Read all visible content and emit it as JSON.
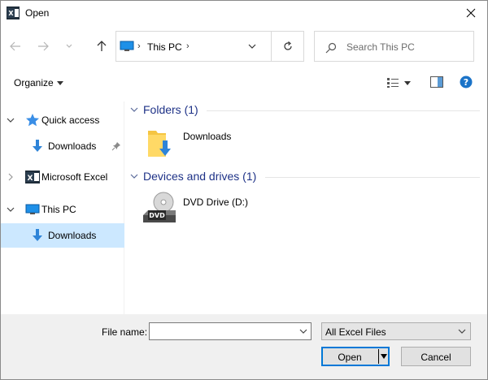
{
  "window": {
    "title": "Open",
    "app_icon": "excel-icon",
    "close_icon": "close-icon"
  },
  "navigation": {
    "back_icon": "arrow-left-icon",
    "forward_icon": "arrow-right-icon",
    "recent_icon": "chevron-down-icon",
    "up_icon": "arrow-up-icon",
    "address": {
      "location": "This PC",
      "refresh_icon": "refresh-icon"
    },
    "search": {
      "placeholder": "Search This PC"
    }
  },
  "commandbar": {
    "organize_label": "Organize",
    "view_icon": "details-view-icon",
    "preview_pane_icon": "preview-pane-icon",
    "help_icon": "help-icon"
  },
  "navpane": {
    "items": [
      {
        "label": "Quick access",
        "icon": "star-icon",
        "expanded": true
      },
      {
        "label": "Downloads",
        "icon": "download-arrow-icon",
        "pinned": true
      },
      {
        "label": "Microsoft Excel",
        "icon": "excel-icon",
        "expanded": false
      },
      {
        "label": "This PC",
        "icon": "computer-icon",
        "expanded": true
      },
      {
        "label": "Downloads",
        "icon": "download-arrow-icon",
        "selected": true
      }
    ]
  },
  "content": {
    "groups": [
      {
        "header": "Folders (1)",
        "items": [
          {
            "label": "Downloads",
            "icon": "downloads-folder-icon"
          }
        ]
      },
      {
        "header": "Devices and drives (1)",
        "items": [
          {
            "label": "DVD Drive (D:)",
            "icon": "dvd-drive-icon",
            "badge": "DVD"
          }
        ]
      }
    ]
  },
  "footer": {
    "filename_label": "File name:",
    "filename_value": "",
    "filter_value": "All Excel Files",
    "open_label": "Open",
    "cancel_label": "Cancel"
  },
  "colors": {
    "accent": "#0078d7",
    "selection": "#cce8ff",
    "group_header": "#1e3287",
    "footer_bg": "#f0f0f0"
  }
}
